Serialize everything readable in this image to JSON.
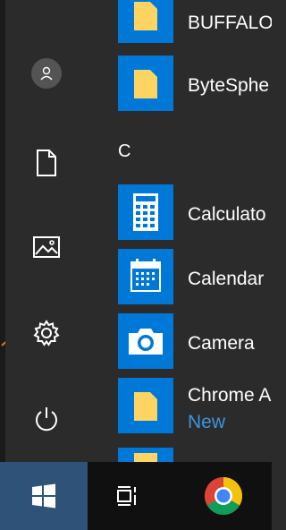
{
  "colors": {
    "background": "#2b2b2b",
    "tile_blue": "#0078d7",
    "folder_yellow": "#fcd462",
    "taskbar": "#101010",
    "start_button": "#2f5278",
    "accent_link": "#3a96dd",
    "arrow": "#e47b1e"
  },
  "rail": {
    "items": [
      {
        "icon": "user-avatar-icon"
      },
      {
        "icon": "document-icon"
      },
      {
        "icon": "pictures-icon"
      },
      {
        "icon": "settings-gear-icon"
      },
      {
        "icon": "power-icon"
      }
    ]
  },
  "applist": {
    "group_letter": "C",
    "apps": [
      {
        "label": "BUFFALO",
        "icon": "folder-icon"
      },
      {
        "label": "ByteSphe",
        "icon": "folder-icon"
      },
      {
        "label": "Calculato",
        "icon": "calculator-icon"
      },
      {
        "label": "Calendar",
        "icon": "calendar-icon"
      },
      {
        "label": "Camera",
        "icon": "camera-icon"
      },
      {
        "label": "Chrome A",
        "sublabel": "New",
        "icon": "folder-icon"
      }
    ]
  },
  "taskbar": {
    "items": [
      {
        "icon": "windows-logo-icon"
      },
      {
        "icon": "task-view-icon"
      },
      {
        "icon": "chrome-icon"
      }
    ]
  }
}
